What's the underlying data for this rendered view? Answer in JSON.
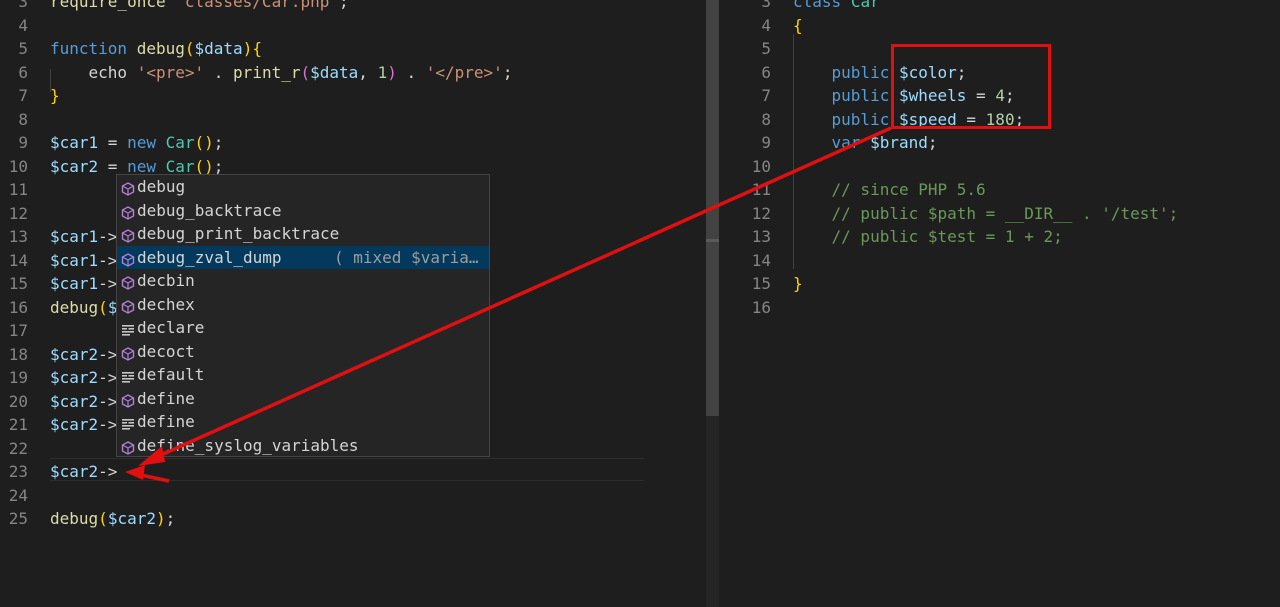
{
  "left_editor": {
    "lines": [
      {
        "n": "3",
        "segments": [
          {
            "t": "require_once",
            "c": "fn"
          },
          {
            "t": " ",
            "c": "plain"
          },
          {
            "t": "'classes/Car.php'",
            "c": "str"
          },
          {
            "t": ";",
            "c": "plain"
          }
        ]
      },
      {
        "n": "4",
        "segments": []
      },
      {
        "n": "5",
        "segments": [
          {
            "t": "function",
            "c": "kw"
          },
          {
            "t": " ",
            "c": "plain"
          },
          {
            "t": "debug",
            "c": "fn"
          },
          {
            "t": "(",
            "c": "br1"
          },
          {
            "t": "$data",
            "c": "var"
          },
          {
            "t": ")",
            "c": "br1"
          },
          {
            "t": "{",
            "c": "br1"
          }
        ]
      },
      {
        "n": "6",
        "segments": [
          {
            "t": "    echo ",
            "c": "plain"
          },
          {
            "t": "'<pre>'",
            "c": "str"
          },
          {
            "t": " . ",
            "c": "plain"
          },
          {
            "t": "print_r",
            "c": "fn"
          },
          {
            "t": "(",
            "c": "br2"
          },
          {
            "t": "$data",
            "c": "var"
          },
          {
            "t": ", ",
            "c": "plain"
          },
          {
            "t": "1",
            "c": "num"
          },
          {
            "t": ")",
            "c": "br2"
          },
          {
            "t": " . ",
            "c": "plain"
          },
          {
            "t": "'</pre>'",
            "c": "str"
          },
          {
            "t": ";",
            "c": "plain"
          }
        ]
      },
      {
        "n": "7",
        "segments": [
          {
            "t": "}",
            "c": "br1"
          }
        ]
      },
      {
        "n": "8",
        "segments": []
      },
      {
        "n": "9",
        "segments": [
          {
            "t": "$car1",
            "c": "var"
          },
          {
            "t": " = ",
            "c": "plain"
          },
          {
            "t": "new",
            "c": "kw"
          },
          {
            "t": " ",
            "c": "plain"
          },
          {
            "t": "Car",
            "c": "cls"
          },
          {
            "t": "()",
            "c": "br1"
          },
          {
            "t": ";",
            "c": "plain"
          }
        ]
      },
      {
        "n": "10",
        "segments": [
          {
            "t": "$car2",
            "c": "var"
          },
          {
            "t": " = ",
            "c": "plain"
          },
          {
            "t": "new",
            "c": "kw"
          },
          {
            "t": " ",
            "c": "plain"
          },
          {
            "t": "Car",
            "c": "cls"
          },
          {
            "t": "()",
            "c": "br1"
          },
          {
            "t": ";",
            "c": "plain"
          }
        ]
      },
      {
        "n": "11",
        "segments": []
      },
      {
        "n": "12",
        "segments": []
      },
      {
        "n": "13",
        "segments": [
          {
            "t": "$car1",
            "c": "var"
          },
          {
            "t": "->",
            "c": "plain"
          }
        ]
      },
      {
        "n": "14",
        "segments": [
          {
            "t": "$car1",
            "c": "var"
          },
          {
            "t": "->",
            "c": "plain"
          }
        ]
      },
      {
        "n": "15",
        "segments": [
          {
            "t": "$car1",
            "c": "var"
          },
          {
            "t": "->",
            "c": "plain"
          }
        ]
      },
      {
        "n": "16",
        "segments": [
          {
            "t": "debug",
            "c": "fn"
          },
          {
            "t": "(",
            "c": "br1"
          },
          {
            "t": "$",
            "c": "var"
          }
        ]
      },
      {
        "n": "17",
        "segments": []
      },
      {
        "n": "18",
        "segments": [
          {
            "t": "$car2",
            "c": "var"
          },
          {
            "t": "->",
            "c": "plain"
          }
        ]
      },
      {
        "n": "19",
        "segments": [
          {
            "t": "$car2",
            "c": "var"
          },
          {
            "t": "->",
            "c": "plain"
          }
        ]
      },
      {
        "n": "20",
        "segments": [
          {
            "t": "$car2",
            "c": "var"
          },
          {
            "t": "->",
            "c": "plain"
          }
        ]
      },
      {
        "n": "21",
        "segments": [
          {
            "t": "$car2",
            "c": "var"
          },
          {
            "t": "->",
            "c": "plain"
          }
        ]
      },
      {
        "n": "22",
        "segments": []
      },
      {
        "n": "23",
        "segments": [
          {
            "t": "$car2",
            "c": "var"
          },
          {
            "t": "->",
            "c": "plain"
          }
        ]
      },
      {
        "n": "24",
        "segments": []
      },
      {
        "n": "25",
        "segments": [
          {
            "t": "debug",
            "c": "fn"
          },
          {
            "t": "(",
            "c": "br1"
          },
          {
            "t": "$car2",
            "c": "var"
          },
          {
            "t": ")",
            "c": "br1"
          },
          {
            "t": ";",
            "c": "plain"
          }
        ]
      }
    ]
  },
  "suggestions": {
    "selected_index": 3,
    "items": [
      {
        "label": "debug",
        "icon": "method-cube-icon",
        "detail": ""
      },
      {
        "label": "debug_backtrace",
        "icon": "method-cube-icon",
        "detail": ""
      },
      {
        "label": "debug_print_backtrace",
        "icon": "method-cube-icon",
        "detail": ""
      },
      {
        "label": "debug_zval_dump",
        "icon": "method-cube-icon",
        "detail": "( mixed $varia…"
      },
      {
        "label": "decbin",
        "icon": "method-cube-icon",
        "detail": ""
      },
      {
        "label": "dechex",
        "icon": "method-cube-icon",
        "detail": ""
      },
      {
        "label": "declare",
        "icon": "keyword-snippet-icon",
        "detail": ""
      },
      {
        "label": "decoct",
        "icon": "method-cube-icon",
        "detail": ""
      },
      {
        "label": "default",
        "icon": "keyword-snippet-icon",
        "detail": ""
      },
      {
        "label": "define",
        "icon": "method-cube-icon",
        "detail": ""
      },
      {
        "label": "define",
        "icon": "keyword-snippet-icon",
        "detail": ""
      },
      {
        "label": "define_syslog_variables",
        "icon": "method-cube-icon",
        "detail": ""
      }
    ]
  },
  "right_editor": {
    "lines": [
      {
        "n": "3",
        "segments": [
          {
            "t": "class",
            "c": "kw"
          },
          {
            "t": " ",
            "c": "plain"
          },
          {
            "t": "Car",
            "c": "cls"
          }
        ]
      },
      {
        "n": "4",
        "segments": [
          {
            "t": "{",
            "c": "br1"
          }
        ]
      },
      {
        "n": "5",
        "segments": []
      },
      {
        "n": "6",
        "segments": [
          {
            "t": "    public",
            "c": "kw"
          },
          {
            "t": " ",
            "c": "plain"
          },
          {
            "t": "$color",
            "c": "var"
          },
          {
            "t": ";",
            "c": "plain"
          }
        ]
      },
      {
        "n": "7",
        "segments": [
          {
            "t": "    public",
            "c": "kw"
          },
          {
            "t": " ",
            "c": "plain"
          },
          {
            "t": "$wheels",
            "c": "var"
          },
          {
            "t": " = ",
            "c": "plain"
          },
          {
            "t": "4",
            "c": "num"
          },
          {
            "t": ";",
            "c": "plain"
          }
        ]
      },
      {
        "n": "8",
        "segments": [
          {
            "t": "    public",
            "c": "kw"
          },
          {
            "t": " ",
            "c": "plain"
          },
          {
            "t": "$speed",
            "c": "var"
          },
          {
            "t": " = ",
            "c": "plain"
          },
          {
            "t": "180",
            "c": "num"
          },
          {
            "t": ";",
            "c": "plain"
          }
        ]
      },
      {
        "n": "9",
        "segments": [
          {
            "t": "    var",
            "c": "kw"
          },
          {
            "t": " ",
            "c": "plain"
          },
          {
            "t": "$brand",
            "c": "var"
          },
          {
            "t": ";",
            "c": "plain"
          }
        ]
      },
      {
        "n": "10",
        "segments": []
      },
      {
        "n": "11",
        "segments": [
          {
            "t": "    // since PHP 5.6",
            "c": "cmt"
          }
        ]
      },
      {
        "n": "12",
        "segments": [
          {
            "t": "    // public $path = __DIR__ . '/test';",
            "c": "cmt"
          }
        ]
      },
      {
        "n": "13",
        "segments": [
          {
            "t": "    // public $test = 1 + 2;",
            "c": "cmt"
          }
        ]
      },
      {
        "n": "14",
        "segments": []
      },
      {
        "n": "15",
        "segments": [
          {
            "t": "}",
            "c": "br1"
          }
        ]
      },
      {
        "n": "16",
        "segments": []
      }
    ]
  },
  "colors": {
    "annotation_red": "#e01010",
    "selection_blue": "#04395e",
    "icon_purple": "#b180d7"
  }
}
